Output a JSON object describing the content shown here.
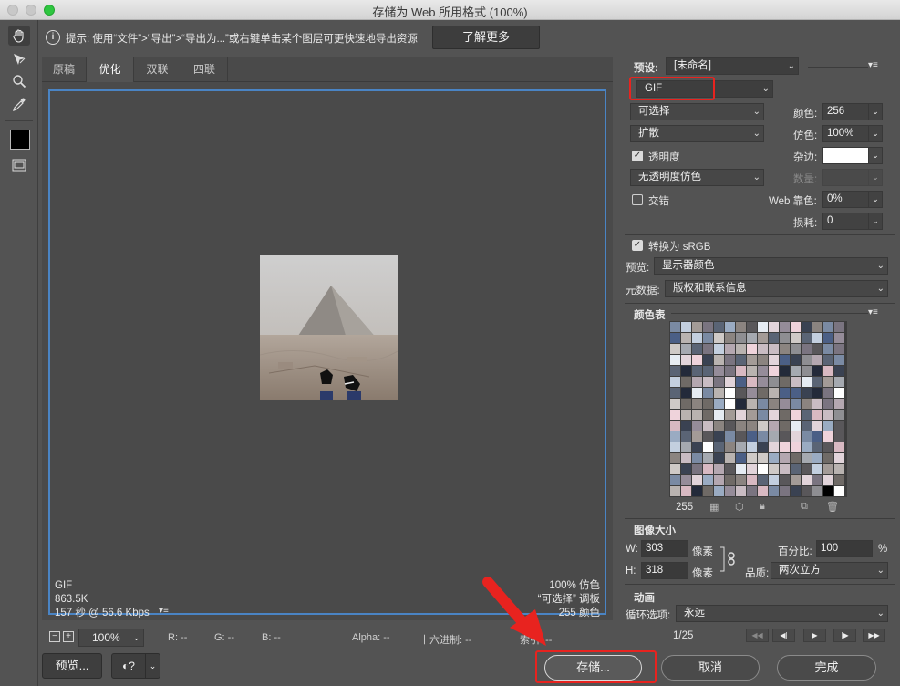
{
  "window": {
    "title": "存储为 Web 所用格式 (100%)"
  },
  "tip": {
    "text": "提示: 使用“文件”>“导出”>“导出为...”或右键单击某个图层可更快速地导出资源",
    "learn_more": "了解更多"
  },
  "tabs": [
    "原稿",
    "优化",
    "双联",
    "四联"
  ],
  "active_tab": "优化",
  "image_info": {
    "format": "GIF",
    "size": "863.5K",
    "time": "157 秒 @ 56.6 Kbps",
    "dither": "100% 仿色",
    "palette": "“可选择” 调板",
    "colors": "255 颜色"
  },
  "status": {
    "zoom": "100%",
    "r": "R: --",
    "g": "G: --",
    "b": "B: --",
    "alpha": "Alpha: --",
    "hex": "十六进制: --",
    "index": "索引: --"
  },
  "buttons": {
    "preview": "预览...",
    "save": "存储...",
    "cancel": "取消",
    "done": "完成"
  },
  "settings": {
    "preset_label": "预设:",
    "preset_value": "[未命名]",
    "format": "GIF",
    "reduction": "可选择",
    "dither_algo": "扩散",
    "transparency": "透明度",
    "transparency_dither": "无透明度仿色",
    "interlaced": "交错",
    "colors_label": "颜色:",
    "colors_value": "256",
    "dither_label": "仿色:",
    "dither_value": "100%",
    "matte_label": "杂边:",
    "amount_label": "数量:",
    "web_snap_label": "Web 靠色:",
    "web_snap_value": "0%",
    "lossy_label": "损耗:",
    "lossy_value": "0",
    "convert_srgb": "转换为 sRGB",
    "preview_label": "预览:",
    "preview_value": "显示器颜色",
    "metadata_label": "元数据:",
    "metadata_value": "版权和联系信息"
  },
  "color_table": {
    "label": "颜色表",
    "count": "255"
  },
  "image_size": {
    "label": "图像大小",
    "w_label": "W:",
    "w_value": "303",
    "h_label": "H:",
    "h_value": "318",
    "unit": "像素",
    "percent_label": "百分比:",
    "percent_value": "100",
    "percent_unit": "%",
    "quality_label": "品质:",
    "quality_value": "两次立方"
  },
  "animation": {
    "label": "动画",
    "loop_label": "循环选项:",
    "loop_value": "永远",
    "frame": "1/25"
  },
  "colors": {
    "accent_blue": "#4a84c4",
    "highlight_red": "#e8231f"
  }
}
